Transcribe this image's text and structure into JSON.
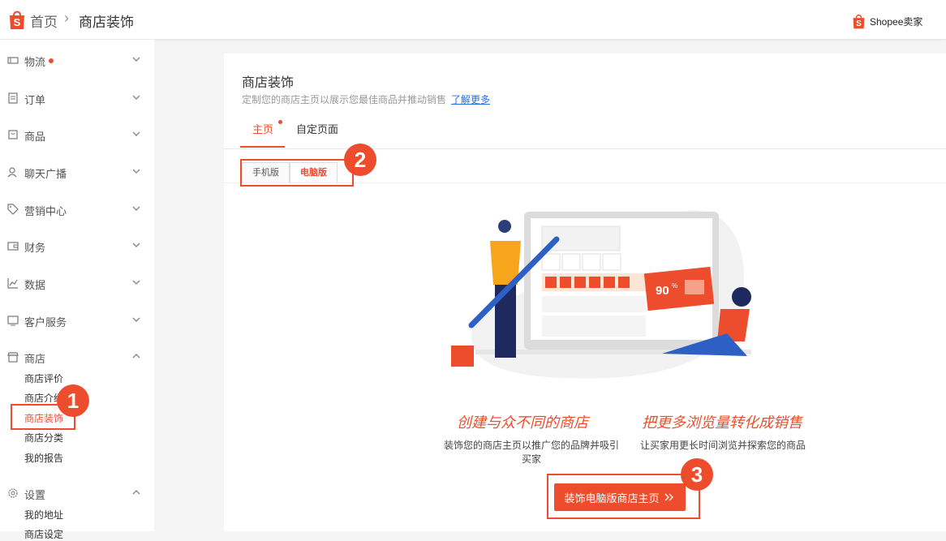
{
  "header": {
    "breadcrumb_home": "首页",
    "breadcrumb_sep": "›",
    "breadcrumb_current": "商店装饰",
    "seller_label": "Shopee卖家"
  },
  "sidebar": {
    "items": [
      {
        "label": "物流",
        "icon": "truck-icon",
        "badge": true
      },
      {
        "label": "订单",
        "icon": "order-icon"
      },
      {
        "label": "商品",
        "icon": "product-icon"
      },
      {
        "label": "聊天广播",
        "icon": "chat-icon"
      },
      {
        "label": "营销中心",
        "icon": "tag-icon"
      },
      {
        "label": "财务",
        "icon": "wallet-icon"
      },
      {
        "label": "数据",
        "icon": "chart-icon"
      },
      {
        "label": "客户服务",
        "icon": "service-icon"
      },
      {
        "label": "商店",
        "icon": "shop-icon",
        "expanded": true
      },
      {
        "label": "设置",
        "icon": "gear-icon",
        "expanded": true
      }
    ],
    "shop_sub": [
      "商店评价",
      "商店介绍",
      "商店装饰",
      "商店分类",
      "我的报告"
    ],
    "settings_sub": [
      "我的地址",
      "商店设定"
    ]
  },
  "card": {
    "title": "商店装饰",
    "desc": "定制您的商店主页以展示您最佳商品并推动销售",
    "learn_more": "了解更多"
  },
  "tabs": {
    "home": "主页",
    "custom": "自定页面"
  },
  "segment": {
    "mobile": "手机版",
    "pc": "电脑版"
  },
  "illustration": {
    "discount": "90",
    "discount_unit": "%"
  },
  "features": [
    {
      "title": "创建与众不同的商店",
      "desc_line1": "装饰您的商店主页以推广您的品牌并吸引",
      "desc_line2": "买家"
    },
    {
      "title": "把更多浏览量转化成销售",
      "desc_line1": "让买家用更长时间浏览并探索您的商品"
    }
  ],
  "cta_label": "装饰电脑版商店主页",
  "cta_icon": "double-chevron-right-icon",
  "annotations": [
    "1",
    "2",
    "3"
  ],
  "colors": {
    "accent": "#ee4d2d",
    "link": "#2673dd"
  }
}
